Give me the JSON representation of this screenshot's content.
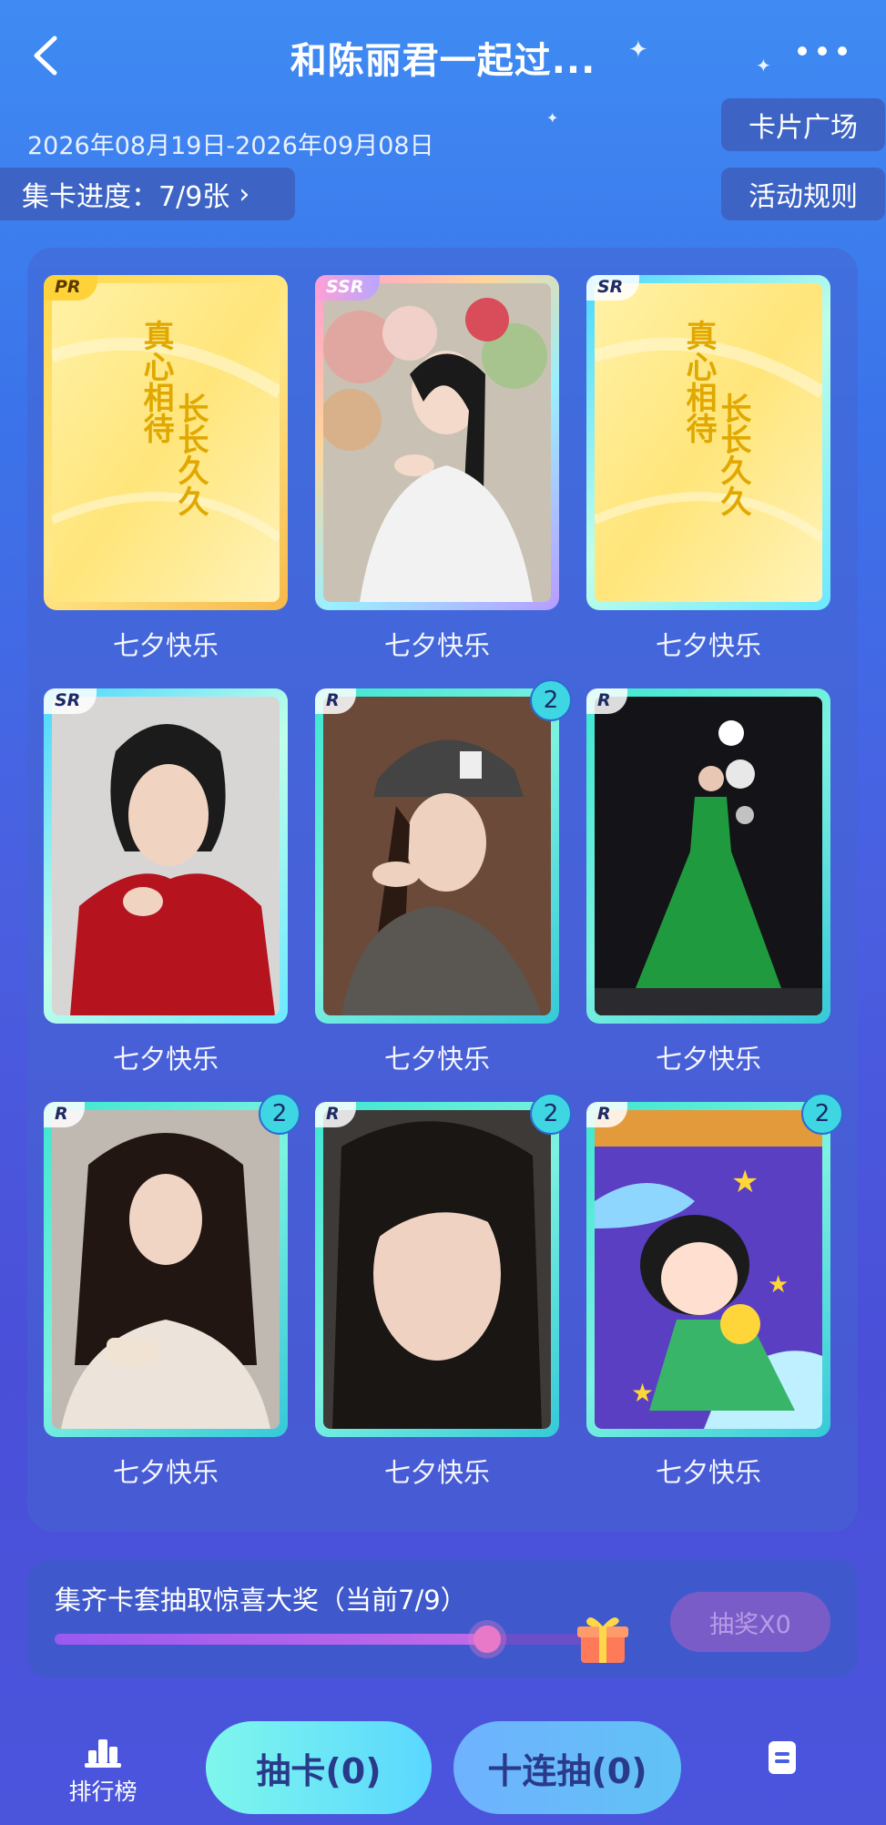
{
  "header": {
    "title": "和陈丽君一起过..."
  },
  "event": {
    "date_range": "2026年08月19日-2026年09月08日"
  },
  "buttons": {
    "progress": "集卡进度：7/9张",
    "card_plaza": "卡片广场",
    "rules": "活动规则"
  },
  "cards": [
    {
      "rarity": "PR",
      "label": "七夕快乐",
      "count": "",
      "art": "yellow-calligraphy"
    },
    {
      "rarity": "SSR",
      "label": "七夕快乐",
      "count": "",
      "art": "portrait-flowers"
    },
    {
      "rarity": "SR",
      "label": "七夕快乐",
      "count": "",
      "art": "yellow-calligraphy"
    },
    {
      "rarity": "SR",
      "label": "七夕快乐",
      "count": "",
      "art": "portrait-red"
    },
    {
      "rarity": "R",
      "label": "七夕快乐",
      "count": "2",
      "art": "portrait-cap"
    },
    {
      "rarity": "R",
      "label": "七夕快乐",
      "count": "",
      "art": "stage-green-dress"
    },
    {
      "rarity": "R",
      "label": "七夕快乐",
      "count": "2",
      "art": "portrait-phone"
    },
    {
      "rarity": "R",
      "label": "七夕快乐",
      "count": "2",
      "art": "portrait-closeup"
    },
    {
      "rarity": "R",
      "label": "七夕快乐",
      "count": "2",
      "art": "cartoon-stars"
    }
  ],
  "calligraphy": {
    "col1": "真心相待",
    "col2": "长长久久"
  },
  "prize": {
    "text": "集齐卡套抽取惊喜大奖（当前7/9）",
    "progress_fraction": 0.778,
    "lottery_button": "抽奖X0"
  },
  "bottom": {
    "ranking": "排行榜",
    "draw": "抽卡(0)",
    "ten_draw": "十连抽(0)"
  },
  "colors": {
    "accent": "#5ad7ff",
    "background": "#4a5ee0"
  }
}
